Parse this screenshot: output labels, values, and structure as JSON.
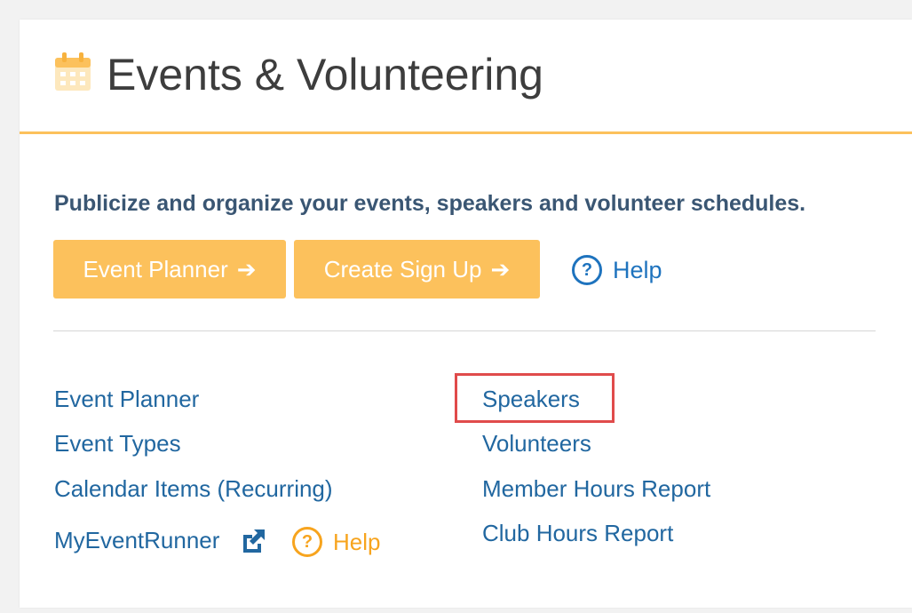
{
  "header": {
    "title": "Events & Volunteering",
    "icon": "calendar-icon"
  },
  "intro": {
    "description": "Publicize and organize your events, speakers and volunteer schedules."
  },
  "actions": {
    "event_planner_label": "Event Planner",
    "create_signup_label": "Create Sign Up",
    "arrow": "➔",
    "help_label": "Help",
    "help_symbol": "?"
  },
  "links": {
    "left": [
      {
        "label": "Event Planner"
      },
      {
        "label": "Event Types"
      },
      {
        "label": "Calendar Items (Recurring)"
      },
      {
        "label": "MyEventRunner",
        "icon": "external-link-icon"
      }
    ],
    "right": [
      {
        "label": "Speakers",
        "highlighted": true
      },
      {
        "label": "Volunteers"
      },
      {
        "label": "Member Hours Report"
      },
      {
        "label": "Club Hours Report"
      }
    ],
    "secondary_help_label": "Help",
    "secondary_help_symbol": "?"
  },
  "colors": {
    "accent": "#fcc15c",
    "link": "#2167a0",
    "help_blue": "#1e73be",
    "help_orange": "#f7a41e",
    "highlight": "#e04b4b"
  }
}
